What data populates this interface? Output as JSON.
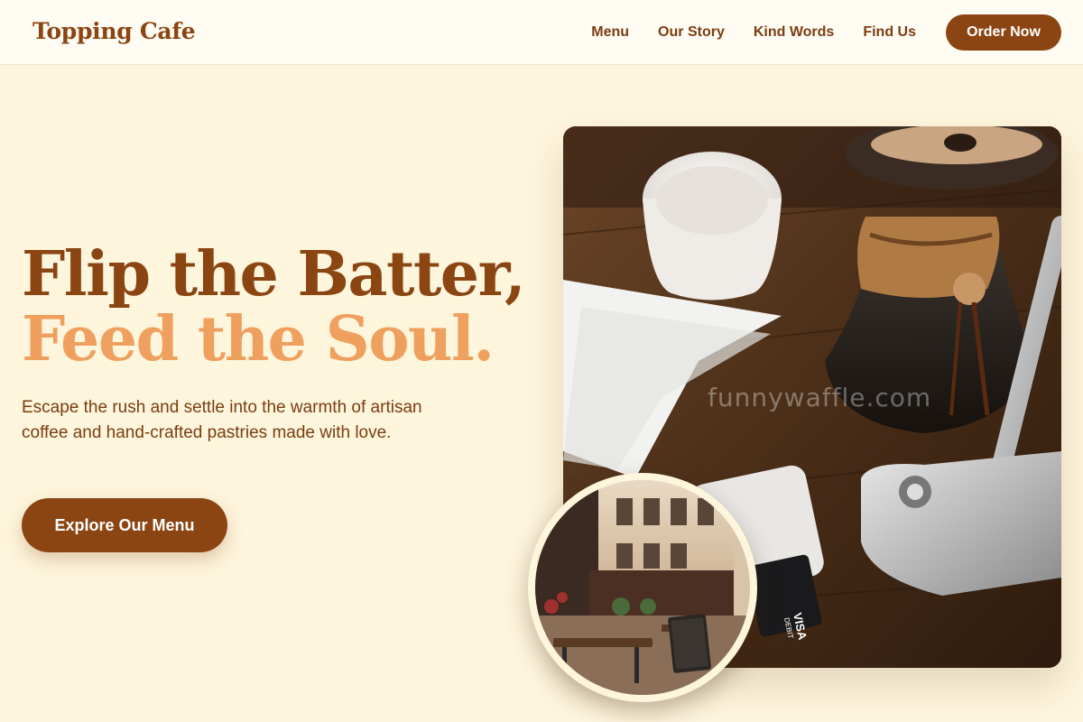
{
  "brand": "Topping Cafe",
  "nav": {
    "links": [
      "Menu",
      "Our Story",
      "Kind Words",
      "Find Us"
    ],
    "order_label": "Order Now"
  },
  "hero": {
    "headline_line1": "Flip the Batter,",
    "headline_line2": "Feed the Soul.",
    "subtitle": "Escape the rush and settle into the warmth of artisan coffee and hand-crafted pastries made with love.",
    "cta_label": "Explore Our Menu",
    "watermark": "funnywaffle.com",
    "card_brand": "VISA",
    "card_type": "DEBIT"
  },
  "colors": {
    "background": "#fdf5dc",
    "primary": "#8b4513",
    "accent": "#f0a05e"
  }
}
